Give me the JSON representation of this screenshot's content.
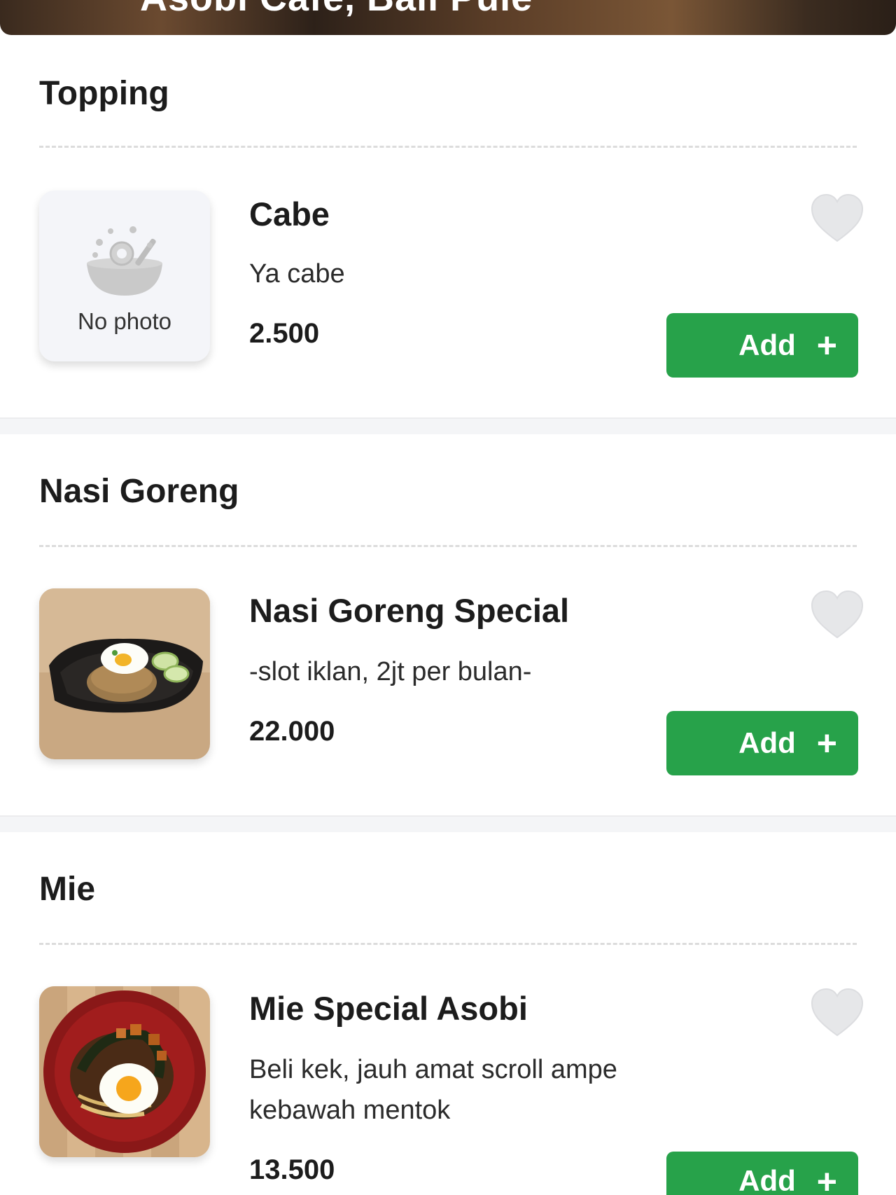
{
  "header": {
    "restaurant_title": "Asobi Cafe, Bali Pule"
  },
  "sections": [
    {
      "title": "Topping",
      "items": [
        {
          "name": "Cabe",
          "description": "Ya cabe",
          "price": "2.500",
          "photo": "no-photo",
          "no_photo_label": "No photo",
          "add_label": "Add",
          "favorited": false
        }
      ]
    },
    {
      "title": "Nasi Goreng",
      "items": [
        {
          "name": "Nasi Goreng Special",
          "description": "-slot iklan, 2jt per bulan-",
          "price": "22.000",
          "photo": "fried-rice-photo",
          "add_label": "Add",
          "favorited": false
        }
      ]
    },
    {
      "title": "Mie",
      "items": [
        {
          "name": "Mie Special Asobi",
          "description": "Beli kek, jauh amat scroll ampe kebawah mentok",
          "price": "13.500",
          "photo": "noodle-photo",
          "add_label": "Add",
          "favorited": false
        }
      ]
    }
  ],
  "colors": {
    "accent_green": "#27a24a",
    "heart_inactive": "#e6e7e9",
    "divider": "#f4f5f7"
  },
  "icons": {
    "favorite": "heart-icon",
    "add": "plus-icon",
    "placeholder": "food-bowl-icon"
  }
}
